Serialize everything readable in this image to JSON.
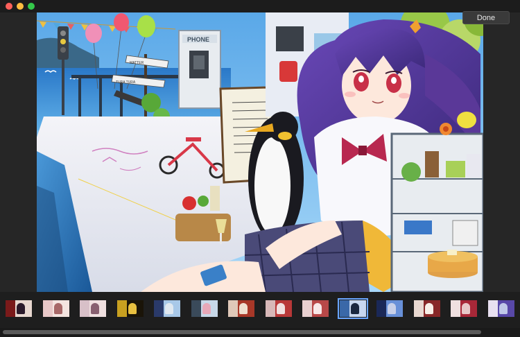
{
  "window": {
    "controls": [
      "close",
      "minimize",
      "zoom"
    ]
  },
  "toolbar": {
    "done_label": "Done"
  },
  "image": {
    "sign_texts": [
      "PHONE",
      "MATTER",
      "TURA TURA"
    ]
  },
  "filmstrip": {
    "thumbnails": [
      {
        "id": "thumb-1",
        "colors": [
          "#7a1a1a",
          "#e8d8d0",
          "#2a1a2a"
        ]
      },
      {
        "id": "thumb-2",
        "colors": [
          "#e8c8c8",
          "#f4e4e0",
          "#a86868"
        ]
      },
      {
        "id": "thumb-3",
        "colors": [
          "#d8c0c8",
          "#f0e0e0",
          "#886070"
        ]
      },
      {
        "id": "thumb-4",
        "colors": [
          "#c8a020",
          "#1a1408",
          "#e8c040"
        ]
      },
      {
        "id": "thumb-5",
        "colors": [
          "#2a3a6a",
          "#a8c8e8",
          "#e0e8f0"
        ]
      },
      {
        "id": "thumb-6",
        "colors": [
          "#3a4a5a",
          "#c8d8e8",
          "#e8a8b8"
        ]
      },
      {
        "id": "thumb-7",
        "colors": [
          "#e0c8b8",
          "#a83828",
          "#f0e0d0"
        ]
      },
      {
        "id": "thumb-8",
        "colors": [
          "#d8b8b8",
          "#b83838",
          "#f0e0e0"
        ]
      },
      {
        "id": "thumb-9",
        "colors": [
          "#e8d0d0",
          "#b84848",
          "#f8e8e8"
        ]
      },
      {
        "id": "thumb-10",
        "colors": [
          "#3a68a8",
          "#c8d8f0",
          "#1a2840"
        ],
        "selected": true
      },
      {
        "id": "thumb-11",
        "colors": [
          "#1a2858",
          "#6890d8",
          "#c8d0e8"
        ]
      },
      {
        "id": "thumb-12",
        "colors": [
          "#e8d8d0",
          "#882828",
          "#f8f0e8"
        ]
      },
      {
        "id": "thumb-13",
        "colors": [
          "#f0e0e0",
          "#a82838",
          "#e8c8c8"
        ]
      },
      {
        "id": "thumb-14",
        "colors": [
          "#e8e0f0",
          "#5848a8",
          "#c0c8e8"
        ]
      },
      {
        "id": "thumb-15",
        "colors": [
          "#283868",
          "#e8d8e0",
          "#b0b8d8"
        ]
      }
    ]
  },
  "scroll": {
    "position": 0.0
  }
}
